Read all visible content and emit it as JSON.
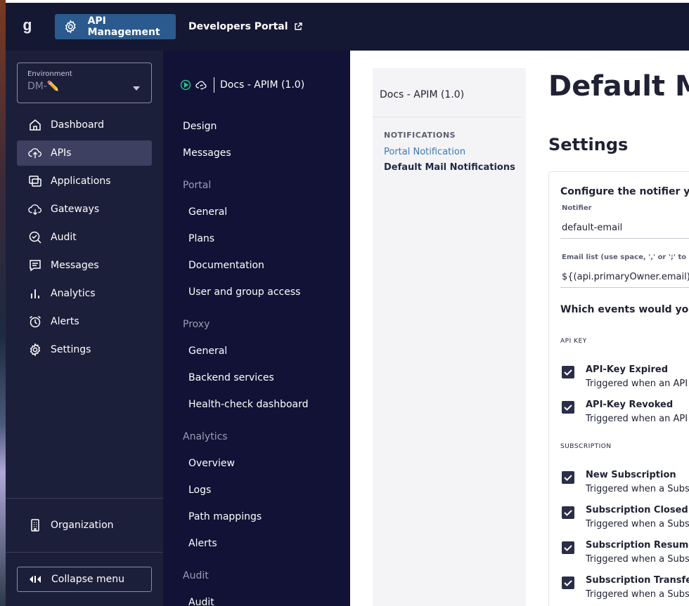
{
  "topbar": {
    "app_button": "API Management",
    "dev_portal": "Developers Portal"
  },
  "sidebar": {
    "environment_label": "Environment",
    "environment_value": "DM-✏️",
    "items": [
      {
        "label": "Dashboard",
        "icon": "home-icon"
      },
      {
        "label": "APIs",
        "icon": "cloud-upload-icon",
        "active": true
      },
      {
        "label": "Applications",
        "icon": "applications-icon"
      },
      {
        "label": "Gateways",
        "icon": "cloud-download-icon"
      },
      {
        "label": "Audit",
        "icon": "audit-search-icon"
      },
      {
        "label": "Messages",
        "icon": "message-icon"
      },
      {
        "label": "Analytics",
        "icon": "bar-chart-icon"
      },
      {
        "label": "Alerts",
        "icon": "alarm-clock-icon"
      },
      {
        "label": "Settings",
        "icon": "gear-icon"
      }
    ],
    "organization": "Organization",
    "collapse": "Collapse menu"
  },
  "subnav": {
    "api_name": "Docs - APIM (1.0)",
    "items": [
      {
        "label": "Design",
        "type": "top"
      },
      {
        "label": "Messages",
        "type": "top"
      },
      {
        "label": "Portal",
        "type": "group"
      },
      {
        "label": "General",
        "type": "sub"
      },
      {
        "label": "Plans",
        "type": "sub"
      },
      {
        "label": "Documentation",
        "type": "sub"
      },
      {
        "label": "User and group access",
        "type": "sub"
      },
      {
        "label": "Proxy",
        "type": "group"
      },
      {
        "label": "General",
        "type": "sub"
      },
      {
        "label": "Backend services",
        "type": "sub"
      },
      {
        "label": "Health-check dashboard",
        "type": "sub"
      },
      {
        "label": "Analytics",
        "type": "group"
      },
      {
        "label": "Overview",
        "type": "sub"
      },
      {
        "label": "Logs",
        "type": "sub"
      },
      {
        "label": "Path mappings",
        "type": "sub"
      },
      {
        "label": "Alerts",
        "type": "sub"
      },
      {
        "label": "Audit",
        "type": "group"
      },
      {
        "label": "Audit",
        "type": "sub"
      }
    ]
  },
  "panel": {
    "title": "Docs - APIM (1.0)",
    "section": "NOTIFICATIONS",
    "link_portal": "Portal Notification",
    "link_default": "Default Mail Notifications"
  },
  "main": {
    "page_title": "Default Ma",
    "settings": "Settings",
    "configure": "Configure the notifier yo",
    "notifier_label": "Notifier",
    "notifier_value": "default-email",
    "email_label": "Email list (use space, ',' or ';' to sepa",
    "email_value": "${(api.primaryOwner.email)!''}",
    "which": "Which events would you",
    "cat_api_key": "API KEY",
    "cat_subscription": "SUBSCRIPTION",
    "events": [
      {
        "name": "API-Key Expired",
        "desc": "Triggered when an API"
      },
      {
        "name": "API-Key Revoked",
        "desc": "Triggered when an API"
      },
      {
        "name": "New Subscription",
        "desc": "Triggered when a Subs"
      },
      {
        "name": "Subscription Closed",
        "desc": "Triggered when a Subs"
      },
      {
        "name": "Subscription Resumed",
        "desc": "Triggered when a Subs"
      },
      {
        "name": "Subscription Transferr",
        "desc": "Triggered when a Subs"
      }
    ]
  }
}
